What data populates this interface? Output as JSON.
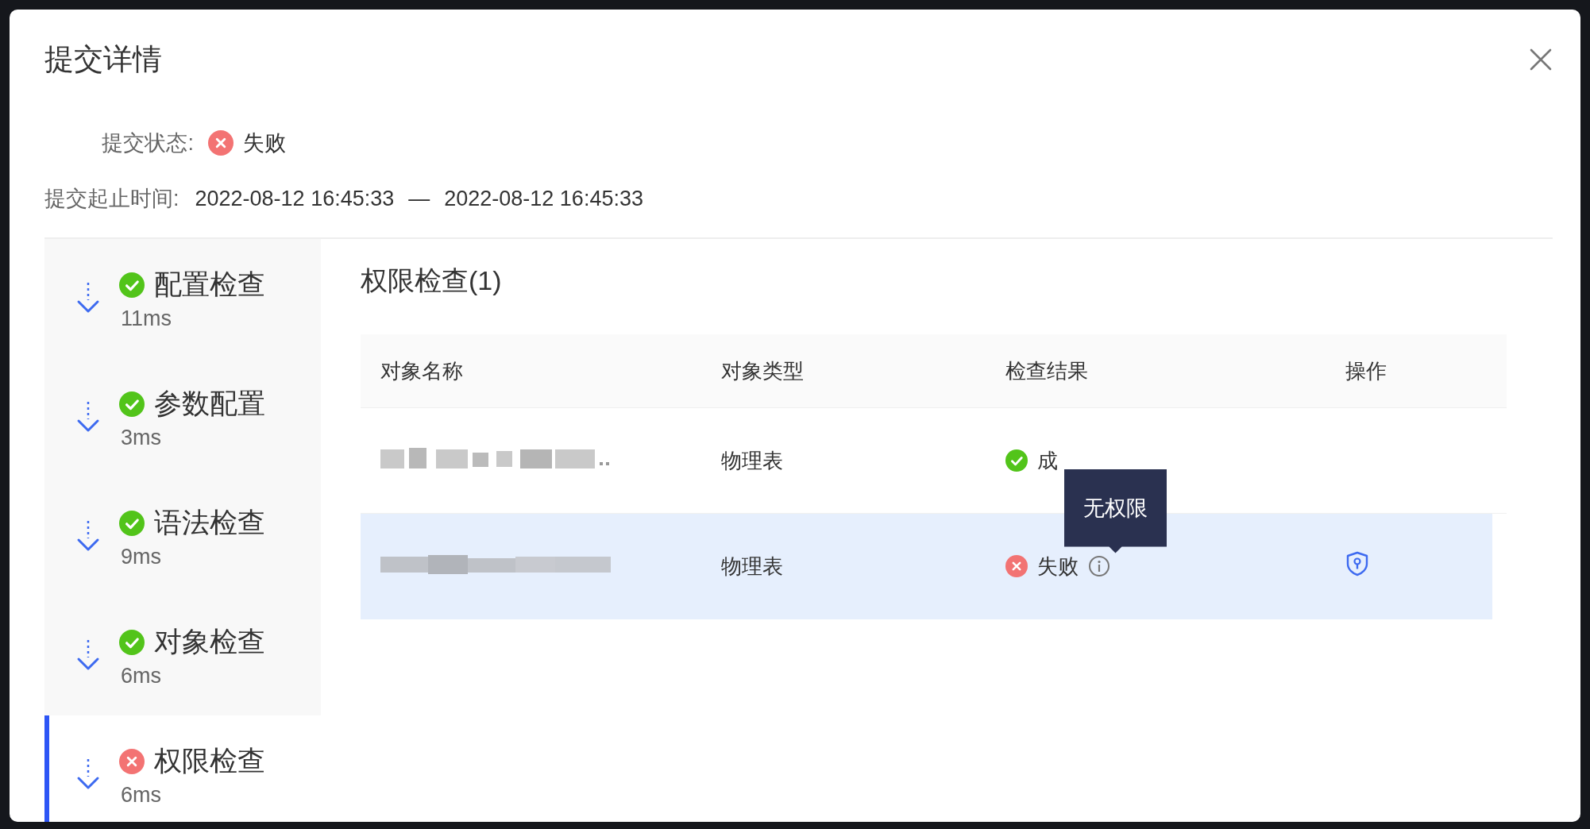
{
  "dialog": {
    "title": "提交详情"
  },
  "submit_status": {
    "label": "提交状态:",
    "passed": false,
    "value": "失败"
  },
  "submit_time": {
    "label": "提交起止时间:",
    "start": "2022-08-12 16:45:33",
    "separator": "—",
    "end": "2022-08-12 16:45:33"
  },
  "steps": [
    {
      "name": "配置检查",
      "duration": "11ms",
      "passed": true,
      "selected": false
    },
    {
      "name": "参数配置",
      "duration": "3ms",
      "passed": true,
      "selected": false
    },
    {
      "name": "语法检查",
      "duration": "9ms",
      "passed": true,
      "selected": false
    },
    {
      "name": "对象检查",
      "duration": "6ms",
      "passed": true,
      "selected": false
    },
    {
      "name": "权限检查",
      "duration": "6ms",
      "passed": false,
      "selected": true
    }
  ],
  "panel": {
    "title": "权限检查(1)",
    "table": {
      "columns": [
        "对象名称",
        "对象类型",
        "检查结果",
        "操作"
      ],
      "rows": [
        {
          "object_type": "物理表",
          "result": "成",
          "passed": true,
          "selected": false,
          "has_info": false,
          "has_action": false
        },
        {
          "object_type": "物理表",
          "result": "失败",
          "passed": false,
          "selected": true,
          "has_info": true,
          "has_action": true,
          "tooltip": "无权限"
        }
      ]
    }
  }
}
